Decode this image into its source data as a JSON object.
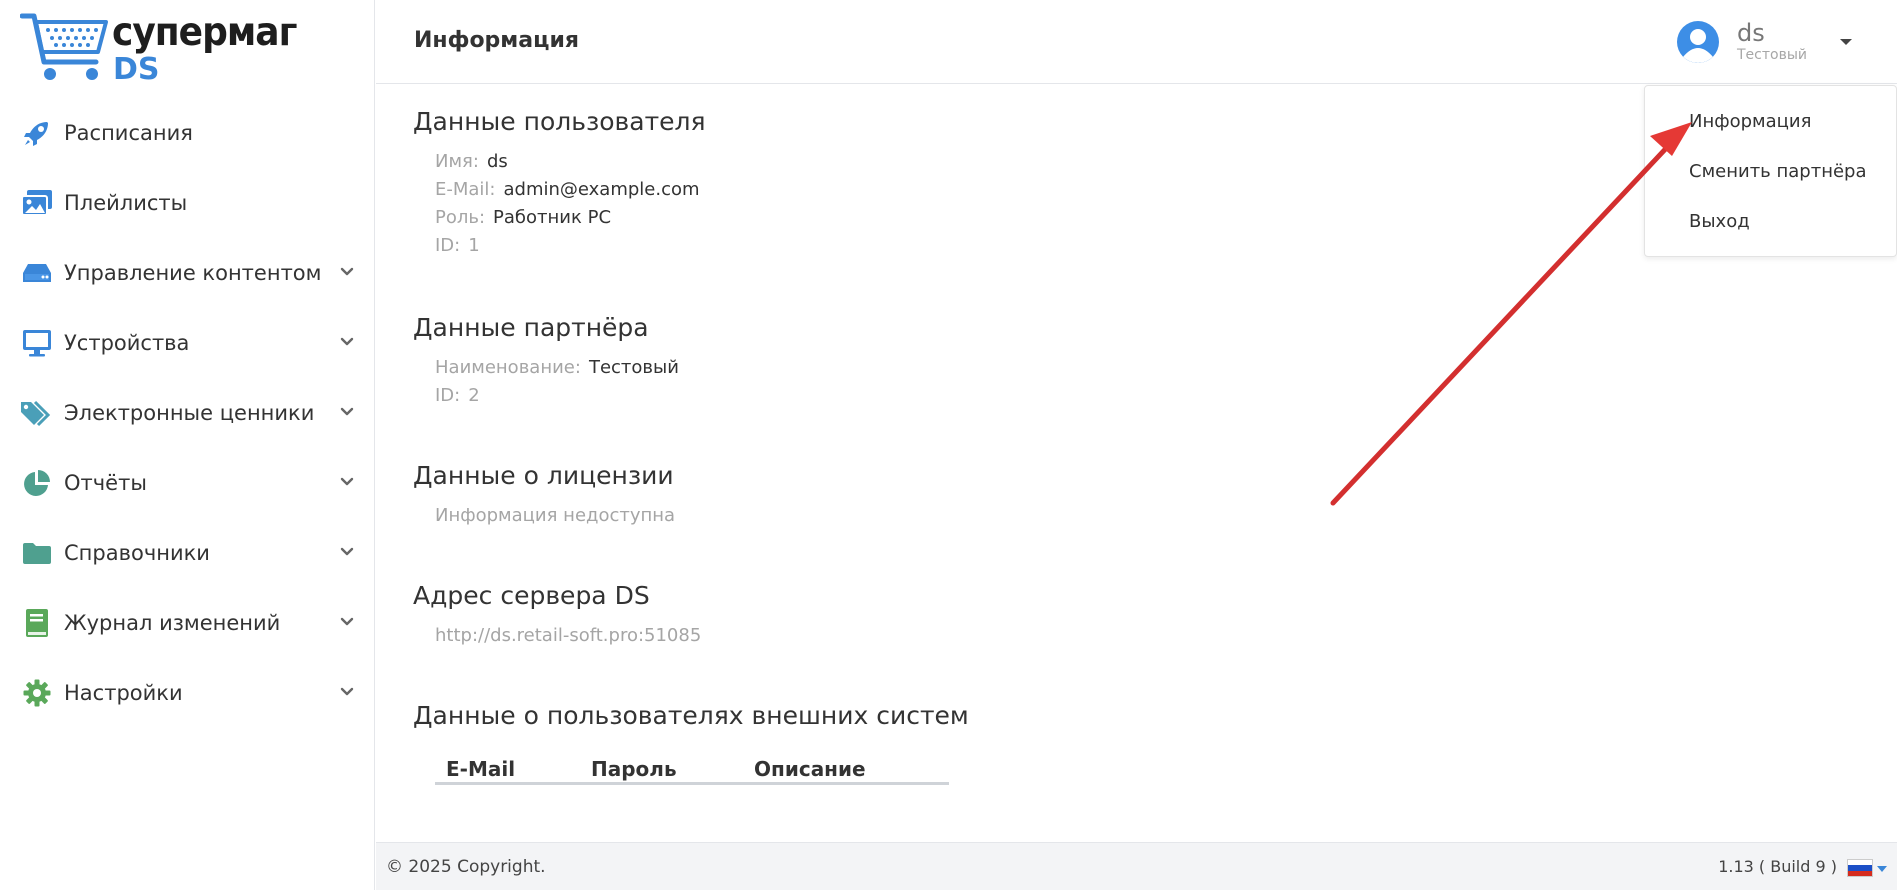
{
  "app": {
    "logo_top": "супермаг",
    "logo_ds": "DS"
  },
  "sidebar": {
    "items": [
      {
        "label": "Расписания",
        "icon": "rocket-icon"
      },
      {
        "label": "Плейлисты",
        "icon": "images-icon"
      },
      {
        "label": "Управление контентом",
        "icon": "hdd-icon"
      },
      {
        "label": "Устройства",
        "icon": "monitor-icon"
      },
      {
        "label": "Электронные ценники",
        "icon": "tags-icon"
      },
      {
        "label": "Отчёты",
        "icon": "pie-chart-icon"
      },
      {
        "label": "Справочники",
        "icon": "folder-icon"
      },
      {
        "label": "Журнал изменений",
        "icon": "book-icon"
      },
      {
        "label": "Настройки",
        "icon": "gear-icon"
      }
    ]
  },
  "header": {
    "title": "Информация",
    "user_name": "ds",
    "user_partner": "Тестовый"
  },
  "dropdown": {
    "items": [
      {
        "label": "Информация"
      },
      {
        "label": "Сменить партнёра"
      },
      {
        "label": "Выход"
      }
    ]
  },
  "user_data": {
    "title": "Данные пользователя",
    "name_key": "Имя:",
    "name_value": "ds",
    "email_key": "E-Mail:",
    "email_value": "admin@example.com",
    "role_key": "Роль:",
    "role_value": "Работник РС",
    "id_key": "ID:",
    "id_value": "1"
  },
  "partner_data": {
    "title": "Данные партнёра",
    "name_key": "Наименование:",
    "name_value": "Тестовый",
    "id_key": "ID:",
    "id_value": "2"
  },
  "license": {
    "title": "Данные о лицензии",
    "text": "Информация недоступна"
  },
  "server": {
    "title": "Адрес сервера DS",
    "url": "http://ds.retail-soft.pro:51085"
  },
  "external_users": {
    "title": "Данные о пользователях внешних систем",
    "columns": [
      "E-Mail",
      "Пароль",
      "Описание"
    ]
  },
  "footer": {
    "copyright": "© 2025 Copyright.",
    "version": "1.13 ( Build 9 )"
  },
  "colors": {
    "accent_blue": "#3a86d8",
    "icon_green": "#5aa88d",
    "annotation_red": "#e53935"
  }
}
